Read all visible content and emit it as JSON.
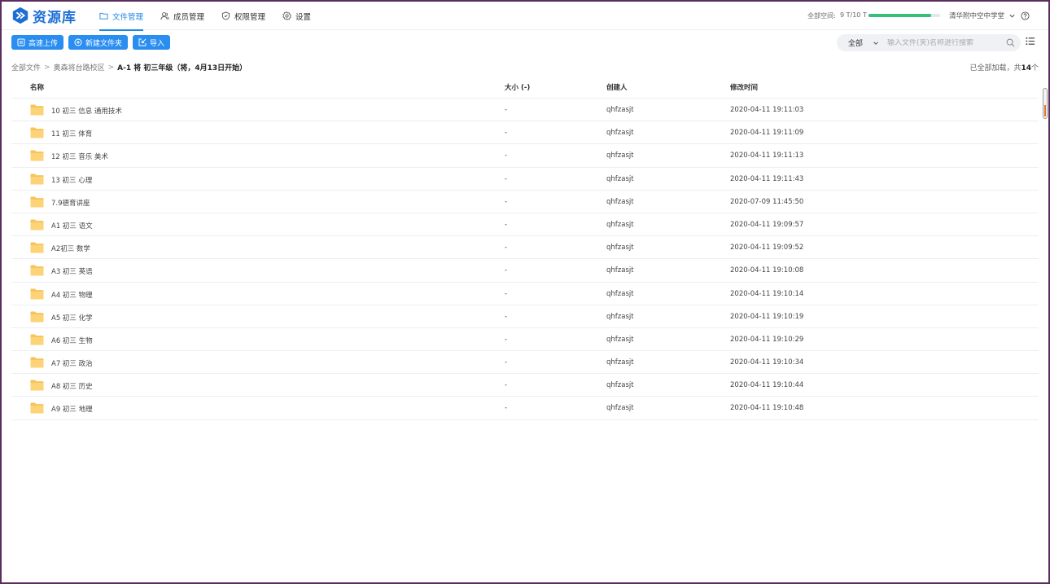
{
  "app": {
    "logo_text": "资源库",
    "brand_color": "#1d6fd6",
    "accent_color": "#1e88e5",
    "storage_fill_fraction": 0.88,
    "storage_color": "#36be7a"
  },
  "nav": [
    {
      "label": "文件管理",
      "icon": "folder-icon",
      "active": true
    },
    {
      "label": "成员管理",
      "icon": "members-icon",
      "active": false
    },
    {
      "label": "权限管理",
      "icon": "shield-icon",
      "active": false
    },
    {
      "label": "设置",
      "icon": "gear-icon",
      "active": false
    }
  ],
  "header": {
    "space_label": "全部空间:",
    "space_value": "9 T/10 T",
    "org_name": "清华附中空中学堂",
    "help_icon": "help-icon"
  },
  "toolbar": {
    "upload_label": "高速上传",
    "new_folder_label": "新建文件夹",
    "import_label": "导入"
  },
  "search": {
    "filter_value": "全部",
    "placeholder": "输入文件(夹)名称进行搜索"
  },
  "breadcrumb": {
    "root": "全部文件",
    "level1": "奥森将台路校区",
    "current": "A-1 将 初三年级（将，4月13日开始）",
    "sep": ">"
  },
  "load_status": {
    "prefix": "已全部加载，共",
    "count": "14",
    "suffix": "个"
  },
  "table": {
    "headers": {
      "name": "名称",
      "size": "大小 (-)",
      "creator": "创建人",
      "modified": "修改时间"
    },
    "rows": [
      {
        "name": "10 初三 信息 通用技术",
        "size": "-",
        "creator": "qhfzasjt",
        "modified": "2020-04-11 19:11:03"
      },
      {
        "name": "11 初三 体育",
        "size": "-",
        "creator": "qhfzasjt",
        "modified": "2020-04-11 19:11:09"
      },
      {
        "name": "12 初三 音乐 美术",
        "size": "-",
        "creator": "qhfzasjt",
        "modified": "2020-04-11 19:11:13"
      },
      {
        "name": "13 初三 心理",
        "size": "-",
        "creator": "qhfzasjt",
        "modified": "2020-04-11 19:11:43"
      },
      {
        "name": "7.9德育讲座",
        "size": "-",
        "creator": "qhfzasjt",
        "modified": "2020-07-09 11:45:50"
      },
      {
        "name": "A1 初三 语文",
        "size": "-",
        "creator": "qhfzasjt",
        "modified": "2020-04-11 19:09:57"
      },
      {
        "name": "A2初三 数学",
        "size": "-",
        "creator": "qhfzasjt",
        "modified": "2020-04-11 19:09:52"
      },
      {
        "name": "A3 初三 英语",
        "size": "-",
        "creator": "qhfzasjt",
        "modified": "2020-04-11 19:10:08"
      },
      {
        "name": "A4 初三 物理",
        "size": "-",
        "creator": "qhfzasjt",
        "modified": "2020-04-11 19:10:14"
      },
      {
        "name": "A5 初三 化学",
        "size": "-",
        "creator": "qhfzasjt",
        "modified": "2020-04-11 19:10:19"
      },
      {
        "name": "A6 初三 生物",
        "size": "-",
        "creator": "qhfzasjt",
        "modified": "2020-04-11 19:10:29"
      },
      {
        "name": "A7 初三 政治",
        "size": "-",
        "creator": "qhfzasjt",
        "modified": "2020-04-11 19:10:34"
      },
      {
        "name": "A8 初三 历史",
        "size": "-",
        "creator": "qhfzasjt",
        "modified": "2020-04-11 19:10:44"
      },
      {
        "name": "A9 初三 地理",
        "size": "-",
        "creator": "qhfzasjt",
        "modified": "2020-04-11 19:10:48"
      }
    ]
  }
}
